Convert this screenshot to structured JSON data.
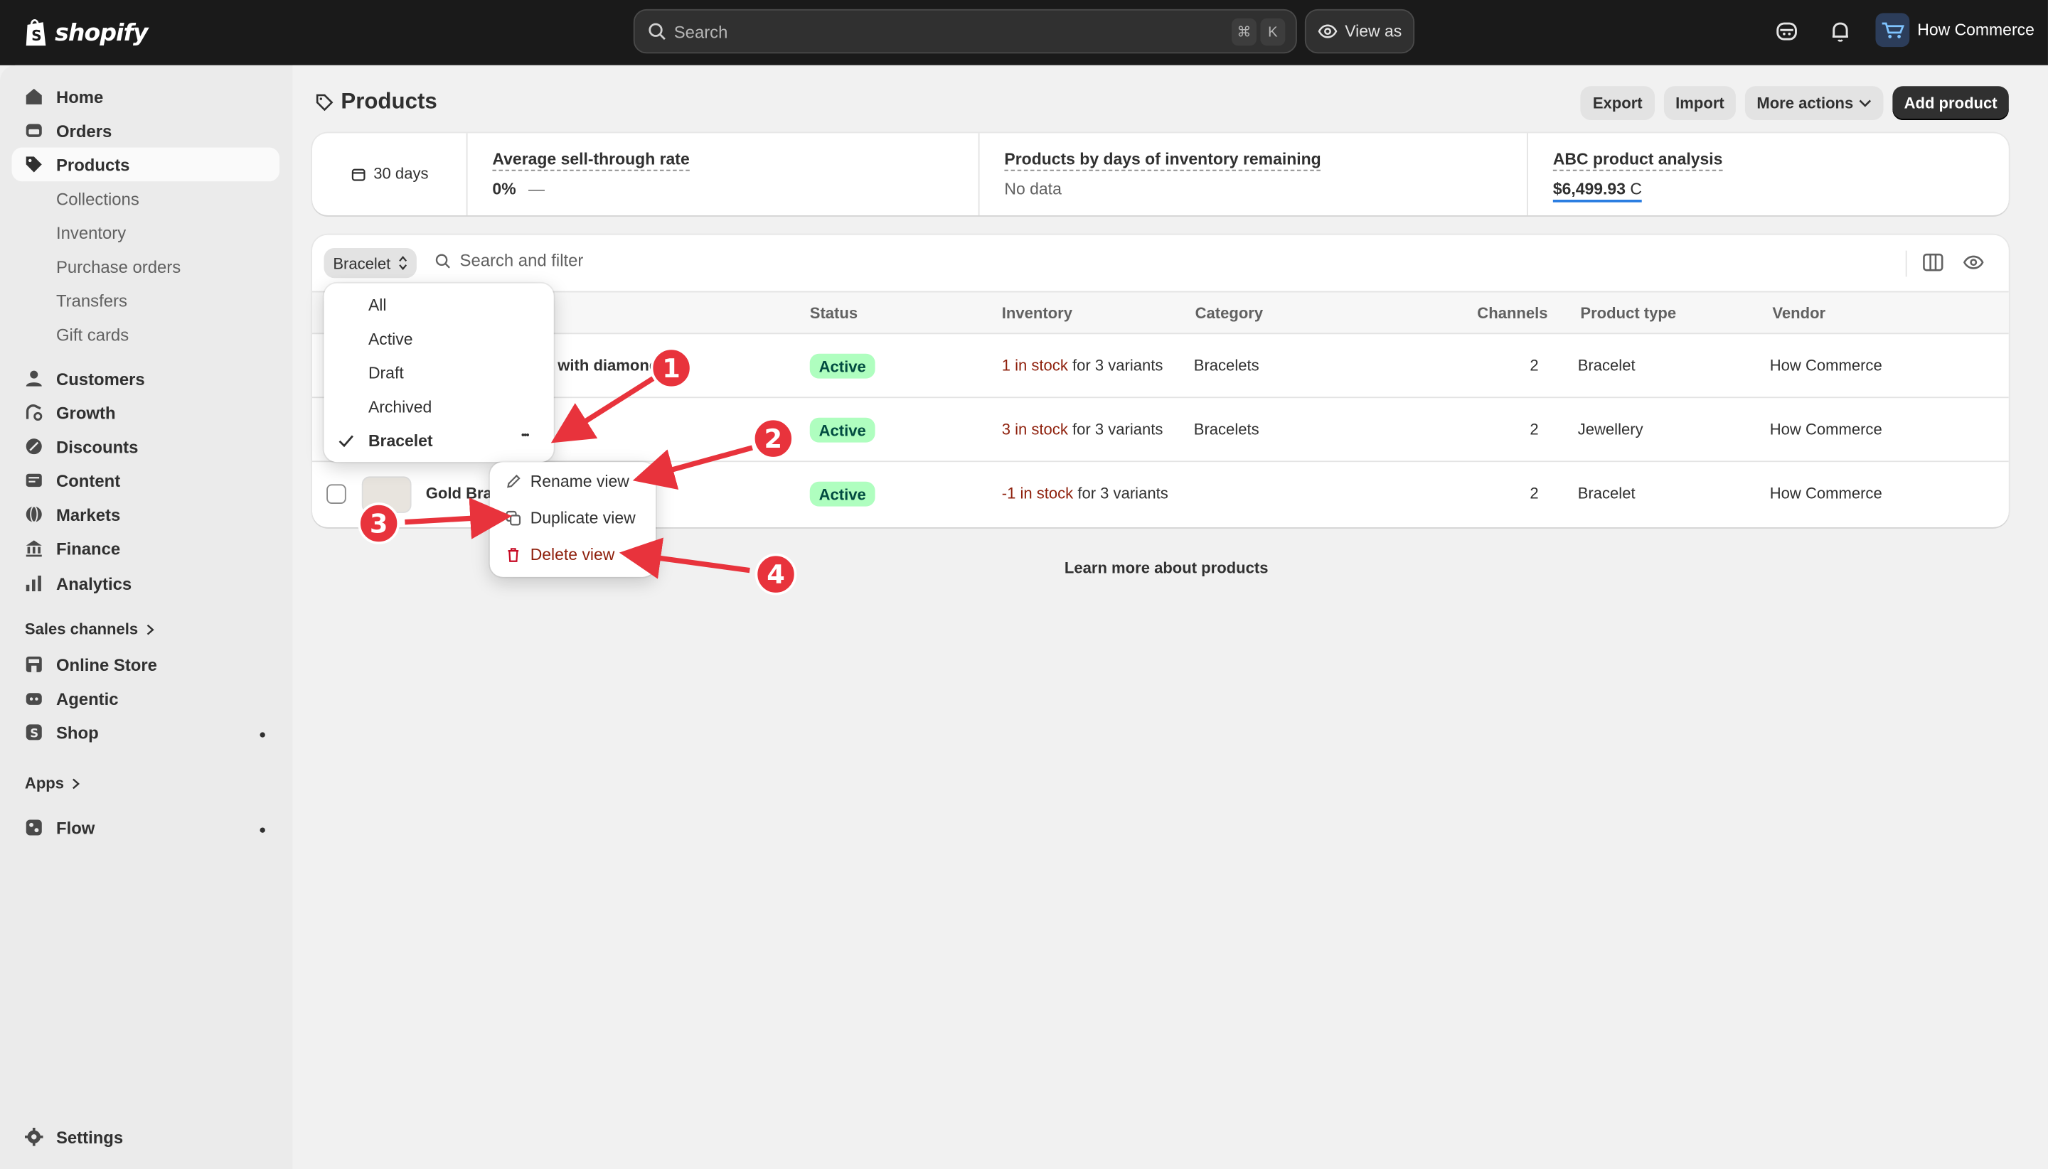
{
  "topbar": {
    "brand": "shopify",
    "search_placeholder": "Search",
    "shortcut_cmd": "⌘",
    "shortcut_key": "K",
    "view_as": "View as",
    "store_name": "How Commerce"
  },
  "sidebar": {
    "items": [
      {
        "label": "Home",
        "icon": "home-icon"
      },
      {
        "label": "Orders",
        "icon": "orders-icon"
      },
      {
        "label": "Products",
        "icon": "tag-icon"
      },
      {
        "label": "Customers",
        "icon": "person-icon"
      },
      {
        "label": "Growth",
        "icon": "growth-icon"
      },
      {
        "label": "Discounts",
        "icon": "discount-icon"
      },
      {
        "label": "Content",
        "icon": "content-icon"
      },
      {
        "label": "Markets",
        "icon": "globe-icon"
      },
      {
        "label": "Finance",
        "icon": "bank-icon"
      },
      {
        "label": "Analytics",
        "icon": "chart-icon"
      }
    ],
    "product_subitems": [
      "Collections",
      "Inventory",
      "Purchase orders",
      "Transfers",
      "Gift cards"
    ],
    "sales_channels_header": "Sales channels",
    "channels": [
      "Online Store",
      "Agentic",
      "Shop"
    ],
    "apps_header": "Apps",
    "apps": [
      "Flow"
    ],
    "settings": "Settings"
  },
  "page": {
    "title": "Products",
    "actions": {
      "export": "Export",
      "import": "Import",
      "more": "More actions",
      "add": "Add product"
    }
  },
  "analytics": {
    "date_range": "30 days",
    "metrics": [
      {
        "title": "Average sell-through rate",
        "value": "0%",
        "trend": "—"
      },
      {
        "title": "Products by days of inventory remaining",
        "value": "No data"
      },
      {
        "title": "ABC product analysis",
        "value": "$6,499.93",
        "grade": "C"
      }
    ]
  },
  "table": {
    "active_view": "Bracelet",
    "filter_placeholder": "Search and filter",
    "columns": [
      "Status",
      "Inventory",
      "Category",
      "Channels",
      "Product type",
      "Vendor"
    ],
    "rows": [
      {
        "product": "with diamond",
        "status": "Active",
        "stock": "1 in stock",
        "variants": "for 3 variants",
        "category": "Bracelets",
        "channels": "2",
        "type": "Bracelet",
        "vendor": "How Commerce"
      },
      {
        "product": "",
        "status": "Active",
        "stock": "3 in stock",
        "variants": "for 3 variants",
        "category": "Bracelets",
        "channels": "2",
        "type": "Jewellery",
        "vendor": "How Commerce"
      },
      {
        "product": "Gold Brac",
        "status": "Active",
        "stock": "-1 in stock",
        "variants": "for 3 variants",
        "category": "",
        "channels": "2",
        "type": "Bracelet",
        "vendor": "How Commerce"
      }
    ],
    "learn_more": "Learn more about products"
  },
  "views_menu": {
    "options": [
      "All",
      "Active",
      "Draft",
      "Archived",
      "Bracelet"
    ],
    "selected": "Bracelet",
    "more_glyph": "•••"
  },
  "view_actions_menu": {
    "items": [
      {
        "label": "Rename view",
        "icon": "pencil-icon"
      },
      {
        "label": "Duplicate view",
        "icon": "duplicate-icon"
      },
      {
        "label": "Delete view",
        "icon": "trash-icon"
      }
    ]
  },
  "annotations": [
    "1",
    "2",
    "3",
    "4"
  ],
  "colors": {
    "topbar": "#1a1a1a",
    "badge_bg": "#affebf",
    "stock_red": "#8e1f0b",
    "annotation_red": "#e8333c",
    "delete_red": "#8e1f0b"
  }
}
